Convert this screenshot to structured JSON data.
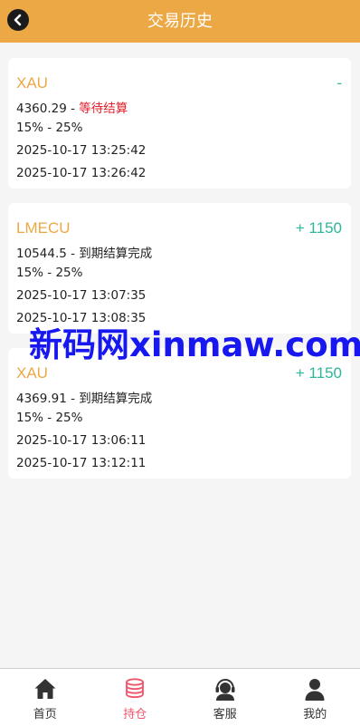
{
  "header": {
    "title": "交易历史"
  },
  "trades": [
    {
      "symbol": "XAU",
      "result": "-",
      "price": "4360.29",
      "separator": " - ",
      "status": "等待结算",
      "range": "15% - 25%",
      "open_time": "2025-10-17 13:25:42",
      "close_time": "2025-10-17 13:26:42"
    },
    {
      "symbol": "LMECU",
      "result": "+ 1150",
      "price": "10544.5",
      "separator": " - ",
      "status": "到期结算完成",
      "range": "15% - 25%",
      "open_time": "2025-10-17 13:07:35",
      "close_time": "2025-10-17 13:08:35"
    },
    {
      "symbol": "XAU",
      "result": "+ 1150",
      "price": "4369.91",
      "separator": " - ",
      "status": "到期结算完成",
      "range": "15% - 25%",
      "open_time": "2025-10-17 13:06:11",
      "close_time": "2025-10-17 13:12:11"
    }
  ],
  "watermark": "新码网xinmaw.com",
  "tabbar": {
    "items": [
      {
        "label": "首页",
        "icon": "home-icon"
      },
      {
        "label": "持仓",
        "icon": "coins-icon",
        "active": true
      },
      {
        "label": "客服",
        "icon": "headset-icon"
      },
      {
        "label": "我的",
        "icon": "user-icon"
      }
    ]
  },
  "colors": {
    "header": "#eca844",
    "symbol": "#eca844",
    "profit": "#2fb59a",
    "pending": "#e0202a",
    "active_tab": "#f0546a"
  }
}
